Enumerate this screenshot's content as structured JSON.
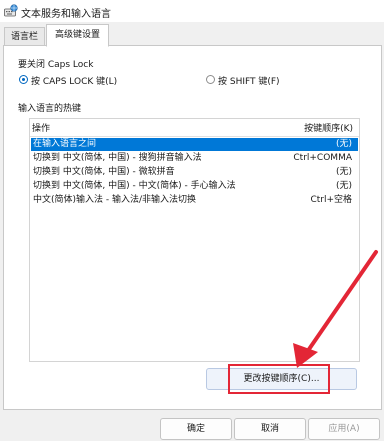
{
  "window": {
    "title": "文本服务和输入语言"
  },
  "tabs": [
    {
      "label": "语言栏",
      "active": false
    },
    {
      "label": "高级键设置",
      "active": true
    }
  ],
  "caps_lock": {
    "group_label": "要关闭 Caps Lock",
    "option1": "按 CAPS LOCK 键(L)",
    "option2": "按 SHIFT 键(F)",
    "selected": "option1"
  },
  "hotkeys": {
    "group_label": "输入语言的热键",
    "col_action": "操作",
    "col_key": "按键顺序(K)",
    "rows": [
      {
        "action": "在输入语言之间",
        "key": "(无)",
        "selected": true
      },
      {
        "action": "切换到 中文(简体, 中国) - 搜狗拼音输入法",
        "key": "Ctrl+COMMA"
      },
      {
        "action": "切换到 中文(简体, 中国) - 微软拼音",
        "key": "(无)"
      },
      {
        "action": "切换到 中文(简体, 中国) - 中文(简体) - 手心输入法",
        "key": "(无)"
      },
      {
        "action": "中文(简体)输入法 - 输入法/非输入法切换",
        "key": "Ctrl+空格"
      }
    ]
  },
  "buttons": {
    "change_key": "更改按键顺序(C)...",
    "ok": "确定",
    "cancel": "取消",
    "apply": "应用(A)"
  },
  "colors": {
    "selection": "#0078d7",
    "annotation": "#e32636"
  },
  "icons": {
    "app": "keyboard-globe-icon"
  }
}
